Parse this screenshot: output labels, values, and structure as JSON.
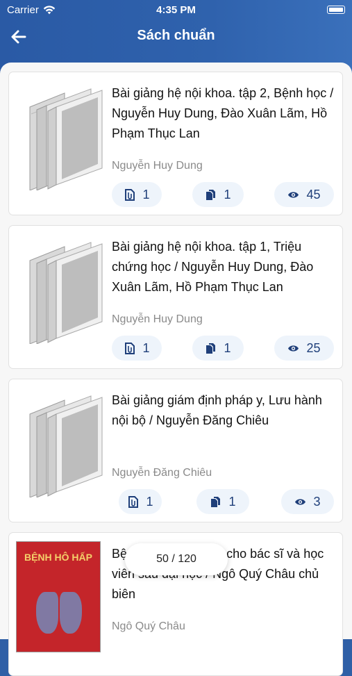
{
  "status_bar": {
    "carrier": "Carrier",
    "time": "4:35 PM"
  },
  "header": {
    "title": "Sách chuẩn"
  },
  "books": [
    {
      "title": "Bài giảng hệ nội khoa. tập 2, Bệnh học / Nguyễn Huy Dung, Đào Xuân Lãm, Hồ Phạm Thục Lan",
      "author": "Nguyễn Huy Dung",
      "files": "1",
      "pages": "1",
      "views": "45",
      "cover": "generic-book"
    },
    {
      "title": "Bài giảng hệ nội khoa. tập 1, Triệu chứng học / Nguyễn Huy Dung, Đào Xuân Lãm, Hồ Phạm Thục Lan",
      "author": "Nguyễn Huy Dung",
      "files": "1",
      "pages": "1",
      "views": "25",
      "cover": "generic-book"
    },
    {
      "title": "Bài giảng giám định pháp y, Lưu hành nội bộ / Nguyễn Đăng Chiêu",
      "author": "Nguyễn Đăng Chiêu",
      "files": "1",
      "pages": "1",
      "views": "3",
      "cover": "generic-book"
    },
    {
      "title": "Bệnh hô hấp : Dùng cho bác sĩ và học viên sau đại học / Ngô Quý Châu chủ biên",
      "author": "Ngô Quý Châu",
      "cover": "red-cover",
      "cover_text": "BỆNH HÔ HẤP"
    }
  ],
  "pager": {
    "label": "50 / 120"
  },
  "colors": {
    "header": "#2f62ad",
    "accent": "#1f3f7a",
    "pill_bg": "#eef4fb"
  }
}
